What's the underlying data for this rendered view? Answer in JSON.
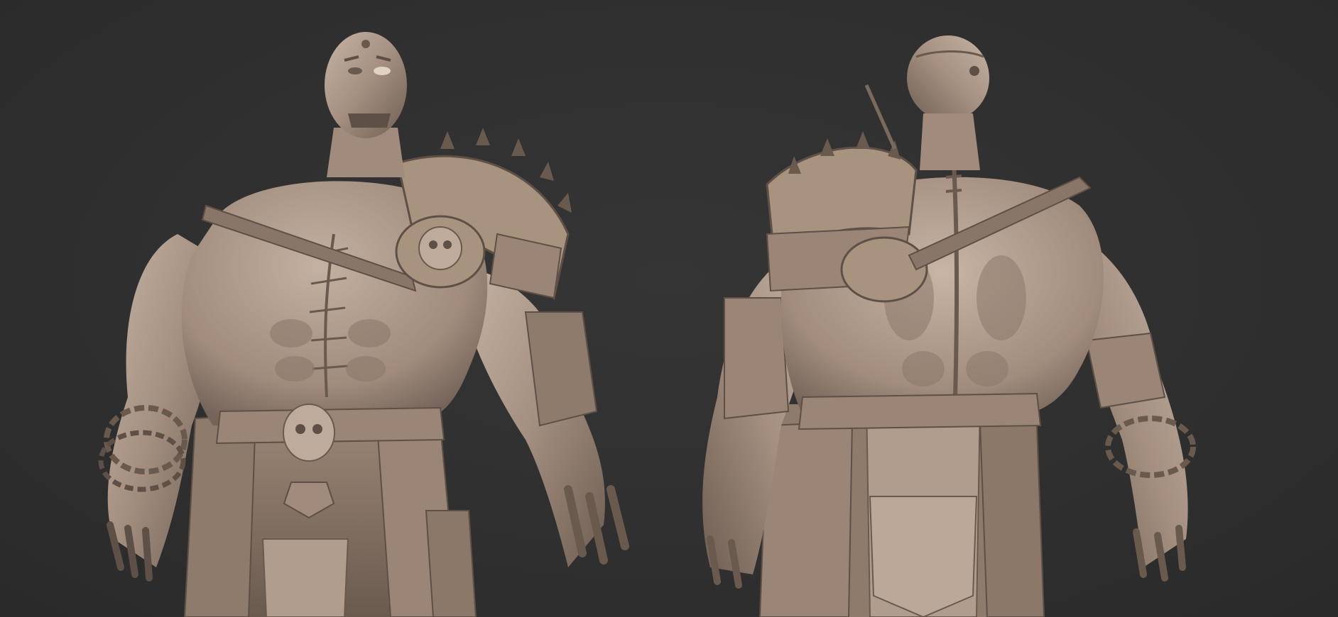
{
  "scene": {
    "background_color": "#2f2f2f",
    "clay_color": "#a48f80",
    "clay_highlight": "#c9b6a6",
    "clay_shadow": "#6e5e52",
    "views": [
      "front",
      "back"
    ]
  }
}
